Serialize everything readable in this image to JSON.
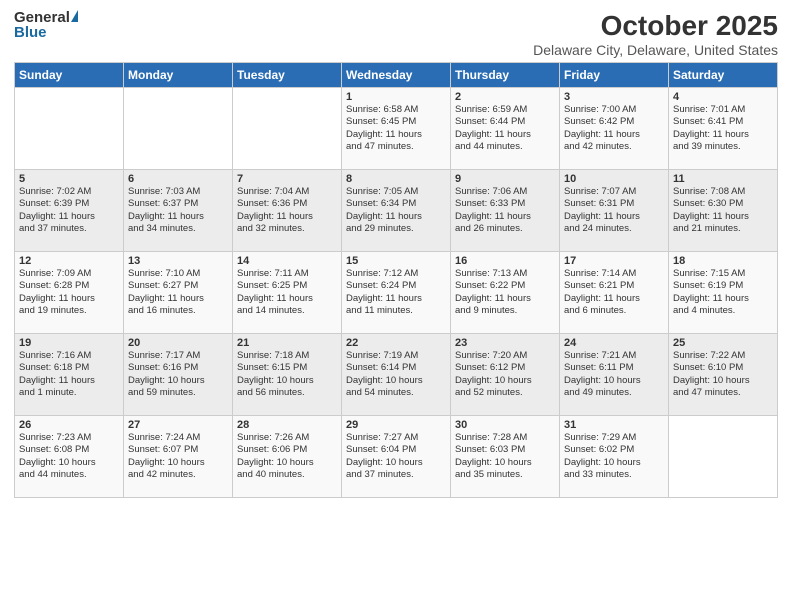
{
  "header": {
    "logo_general": "General",
    "logo_blue": "Blue",
    "title": "October 2025",
    "subtitle": "Delaware City, Delaware, United States"
  },
  "weekdays": [
    "Sunday",
    "Monday",
    "Tuesday",
    "Wednesday",
    "Thursday",
    "Friday",
    "Saturday"
  ],
  "weeks": [
    [
      {
        "day": "",
        "lines": []
      },
      {
        "day": "",
        "lines": []
      },
      {
        "day": "",
        "lines": []
      },
      {
        "day": "1",
        "lines": [
          "Sunrise: 6:58 AM",
          "Sunset: 6:45 PM",
          "Daylight: 11 hours",
          "and 47 minutes."
        ]
      },
      {
        "day": "2",
        "lines": [
          "Sunrise: 6:59 AM",
          "Sunset: 6:44 PM",
          "Daylight: 11 hours",
          "and 44 minutes."
        ]
      },
      {
        "day": "3",
        "lines": [
          "Sunrise: 7:00 AM",
          "Sunset: 6:42 PM",
          "Daylight: 11 hours",
          "and 42 minutes."
        ]
      },
      {
        "day": "4",
        "lines": [
          "Sunrise: 7:01 AM",
          "Sunset: 6:41 PM",
          "Daylight: 11 hours",
          "and 39 minutes."
        ]
      }
    ],
    [
      {
        "day": "5",
        "lines": [
          "Sunrise: 7:02 AM",
          "Sunset: 6:39 PM",
          "Daylight: 11 hours",
          "and 37 minutes."
        ]
      },
      {
        "day": "6",
        "lines": [
          "Sunrise: 7:03 AM",
          "Sunset: 6:37 PM",
          "Daylight: 11 hours",
          "and 34 minutes."
        ]
      },
      {
        "day": "7",
        "lines": [
          "Sunrise: 7:04 AM",
          "Sunset: 6:36 PM",
          "Daylight: 11 hours",
          "and 32 minutes."
        ]
      },
      {
        "day": "8",
        "lines": [
          "Sunrise: 7:05 AM",
          "Sunset: 6:34 PM",
          "Daylight: 11 hours",
          "and 29 minutes."
        ]
      },
      {
        "day": "9",
        "lines": [
          "Sunrise: 7:06 AM",
          "Sunset: 6:33 PM",
          "Daylight: 11 hours",
          "and 26 minutes."
        ]
      },
      {
        "day": "10",
        "lines": [
          "Sunrise: 7:07 AM",
          "Sunset: 6:31 PM",
          "Daylight: 11 hours",
          "and 24 minutes."
        ]
      },
      {
        "day": "11",
        "lines": [
          "Sunrise: 7:08 AM",
          "Sunset: 6:30 PM",
          "Daylight: 11 hours",
          "and 21 minutes."
        ]
      }
    ],
    [
      {
        "day": "12",
        "lines": [
          "Sunrise: 7:09 AM",
          "Sunset: 6:28 PM",
          "Daylight: 11 hours",
          "and 19 minutes."
        ]
      },
      {
        "day": "13",
        "lines": [
          "Sunrise: 7:10 AM",
          "Sunset: 6:27 PM",
          "Daylight: 11 hours",
          "and 16 minutes."
        ]
      },
      {
        "day": "14",
        "lines": [
          "Sunrise: 7:11 AM",
          "Sunset: 6:25 PM",
          "Daylight: 11 hours",
          "and 14 minutes."
        ]
      },
      {
        "day": "15",
        "lines": [
          "Sunrise: 7:12 AM",
          "Sunset: 6:24 PM",
          "Daylight: 11 hours",
          "and 11 minutes."
        ]
      },
      {
        "day": "16",
        "lines": [
          "Sunrise: 7:13 AM",
          "Sunset: 6:22 PM",
          "Daylight: 11 hours",
          "and 9 minutes."
        ]
      },
      {
        "day": "17",
        "lines": [
          "Sunrise: 7:14 AM",
          "Sunset: 6:21 PM",
          "Daylight: 11 hours",
          "and 6 minutes."
        ]
      },
      {
        "day": "18",
        "lines": [
          "Sunrise: 7:15 AM",
          "Sunset: 6:19 PM",
          "Daylight: 11 hours",
          "and 4 minutes."
        ]
      }
    ],
    [
      {
        "day": "19",
        "lines": [
          "Sunrise: 7:16 AM",
          "Sunset: 6:18 PM",
          "Daylight: 11 hours",
          "and 1 minute."
        ]
      },
      {
        "day": "20",
        "lines": [
          "Sunrise: 7:17 AM",
          "Sunset: 6:16 PM",
          "Daylight: 10 hours",
          "and 59 minutes."
        ]
      },
      {
        "day": "21",
        "lines": [
          "Sunrise: 7:18 AM",
          "Sunset: 6:15 PM",
          "Daylight: 10 hours",
          "and 56 minutes."
        ]
      },
      {
        "day": "22",
        "lines": [
          "Sunrise: 7:19 AM",
          "Sunset: 6:14 PM",
          "Daylight: 10 hours",
          "and 54 minutes."
        ]
      },
      {
        "day": "23",
        "lines": [
          "Sunrise: 7:20 AM",
          "Sunset: 6:12 PM",
          "Daylight: 10 hours",
          "and 52 minutes."
        ]
      },
      {
        "day": "24",
        "lines": [
          "Sunrise: 7:21 AM",
          "Sunset: 6:11 PM",
          "Daylight: 10 hours",
          "and 49 minutes."
        ]
      },
      {
        "day": "25",
        "lines": [
          "Sunrise: 7:22 AM",
          "Sunset: 6:10 PM",
          "Daylight: 10 hours",
          "and 47 minutes."
        ]
      }
    ],
    [
      {
        "day": "26",
        "lines": [
          "Sunrise: 7:23 AM",
          "Sunset: 6:08 PM",
          "Daylight: 10 hours",
          "and 44 minutes."
        ]
      },
      {
        "day": "27",
        "lines": [
          "Sunrise: 7:24 AM",
          "Sunset: 6:07 PM",
          "Daylight: 10 hours",
          "and 42 minutes."
        ]
      },
      {
        "day": "28",
        "lines": [
          "Sunrise: 7:26 AM",
          "Sunset: 6:06 PM",
          "Daylight: 10 hours",
          "and 40 minutes."
        ]
      },
      {
        "day": "29",
        "lines": [
          "Sunrise: 7:27 AM",
          "Sunset: 6:04 PM",
          "Daylight: 10 hours",
          "and 37 minutes."
        ]
      },
      {
        "day": "30",
        "lines": [
          "Sunrise: 7:28 AM",
          "Sunset: 6:03 PM",
          "Daylight: 10 hours",
          "and 35 minutes."
        ]
      },
      {
        "day": "31",
        "lines": [
          "Sunrise: 7:29 AM",
          "Sunset: 6:02 PM",
          "Daylight: 10 hours",
          "and 33 minutes."
        ]
      },
      {
        "day": "",
        "lines": []
      }
    ]
  ]
}
